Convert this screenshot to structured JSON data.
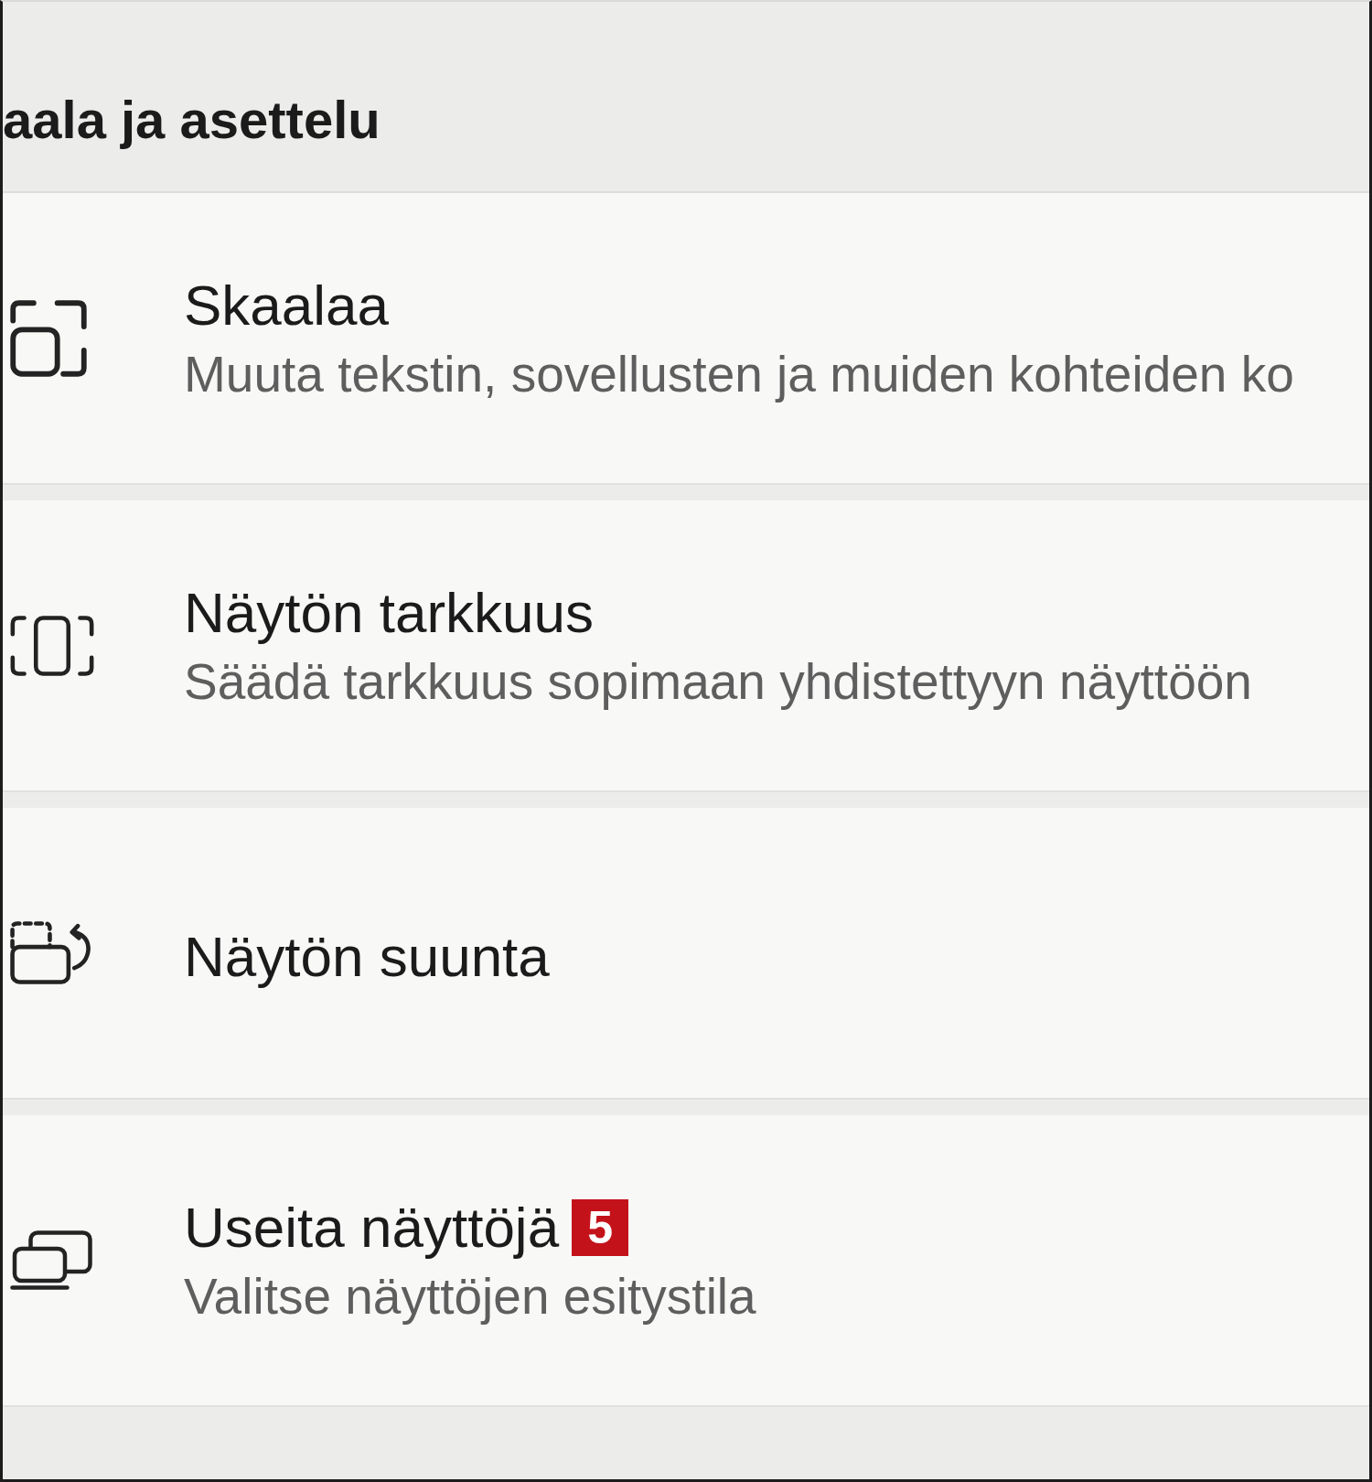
{
  "header": {
    "title": "aala ja asettelu"
  },
  "items": [
    {
      "kind": "scale",
      "title": "Skaalaa",
      "subtitle": "Muuta tekstin, sovellusten ja muiden kohteiden ko"
    },
    {
      "kind": "resolution",
      "title": "Näytön tarkkuus",
      "subtitle": "Säädä tarkkuus sopimaan yhdistettyyn näyttöön"
    },
    {
      "kind": "orientation",
      "title": "Näytön suunta"
    },
    {
      "kind": "multiple",
      "title": "Useita näyttöjä",
      "badge": "5",
      "subtitle": "Valitse näyttöjen esitystila"
    }
  ]
}
